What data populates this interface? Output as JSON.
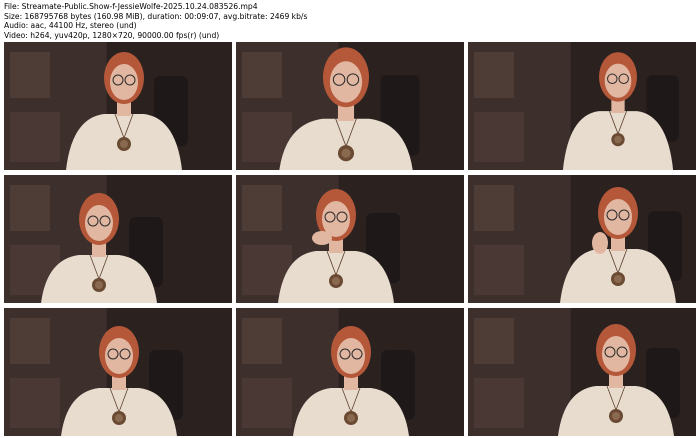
{
  "info": {
    "file_line": "File: Streamate-Public.Show-f-JessieWolfe-2025.10.24.083526.mp4",
    "size_line": "Size: 168795768 bytes (160.98 MiB), duration: 00:09:07, avg.bitrate: 2469 kb/s",
    "audio_line": "Audio: aac, 44100 Hz, stereo (und)",
    "video_line": "Video: h264, yuv420p, 1280×720, 90000.00 fps(r) (und)"
  },
  "thumbnails": [
    {
      "id": 1,
      "pose": "center"
    },
    {
      "id": 2,
      "pose": "close"
    },
    {
      "id": 3,
      "pose": "right"
    },
    {
      "id": 4,
      "pose": "left-lean"
    },
    {
      "id": 5,
      "pose": "hand-neck"
    },
    {
      "id": 6,
      "pose": "hand-chin"
    },
    {
      "id": 7,
      "pose": "center-low"
    },
    {
      "id": 8,
      "pose": "center-low"
    },
    {
      "id": 9,
      "pose": "right-low"
    }
  ],
  "colors": {
    "sheet_background": "#ffffff",
    "room_dark": "#2b2220",
    "room_wall": "#4a3a36",
    "sweater": "#e8dccf",
    "hair": "#b5583a",
    "skin": "#e2b7a2"
  }
}
